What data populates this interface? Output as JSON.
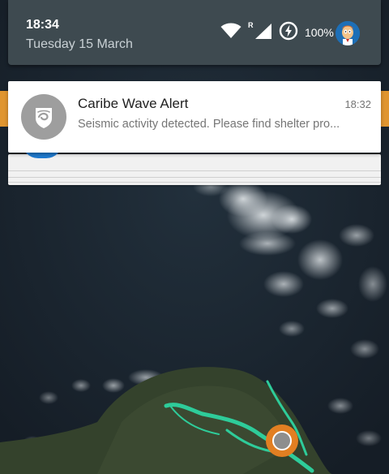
{
  "status_bar": {
    "time": "18:34",
    "date": "Tuesday 15 March",
    "wifi_icon": "wifi-icon",
    "roaming": "R",
    "signal_icon": "cell-signal-icon",
    "battery_icon": "battery-charging-icon",
    "battery_percent": "100%",
    "avatar_icon": "user-avatar-icon"
  },
  "notification": {
    "app_icon": "caribe-wave-logo-icon",
    "title": "Caribe Wave Alert",
    "time": "18:32",
    "text": "Seismic activity detected. Please find shelter pro..."
  },
  "map": {
    "marker_icon": "location-marker-icon",
    "colors": {
      "ocean": "#1b2530",
      "land": "#3a4a30",
      "route": "#2ecc9a",
      "app_bar": "#e0952f"
    }
  }
}
